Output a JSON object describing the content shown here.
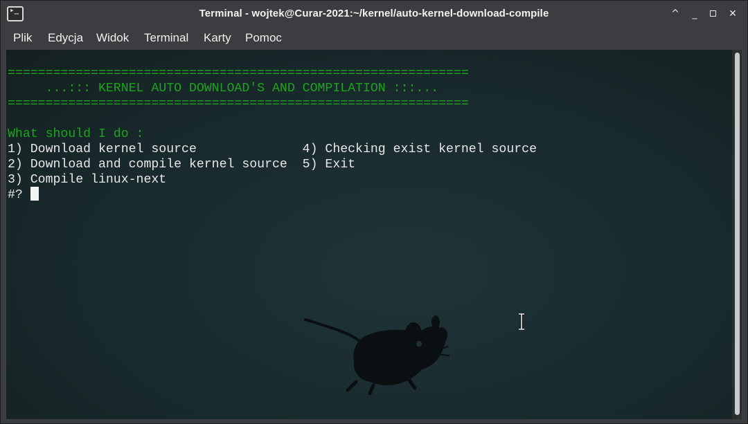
{
  "window": {
    "title": "Terminal - wojtek@Curar-2021:~/kernel/auto-kernel-download-compile",
    "app_icon_glyph": "▸_",
    "controls": {
      "up": "^",
      "minimize": "_",
      "close": "✕"
    }
  },
  "menubar": {
    "items": [
      "Plik",
      "Edycja",
      "Widok",
      "Terminal",
      "Karty",
      "Pomoc"
    ]
  },
  "terminal": {
    "separator_top": "=============================================================",
    "banner": "     ...::: KERNEL AUTO DOWNLOAD'S AND COMPILATION :::...",
    "separator_bottom": "=============================================================",
    "question": "What should I do :",
    "options_rows": [
      "1) Download kernel source              4) Checking exist kernel source",
      "2) Download and compile kernel source  5) Exit",
      "3) Compile linux-next"
    ],
    "prompt": "#? "
  },
  "colors": {
    "titlebar": "#3b3d40",
    "terminal_bg": "#192a2d",
    "green_text": "#1fa31f",
    "white_text": "#e8e8e8"
  },
  "icons": {
    "app": "terminal-icon",
    "background_logo": "xfce-mouse-icon",
    "text_cursor": "ibeam-cursor-icon"
  }
}
